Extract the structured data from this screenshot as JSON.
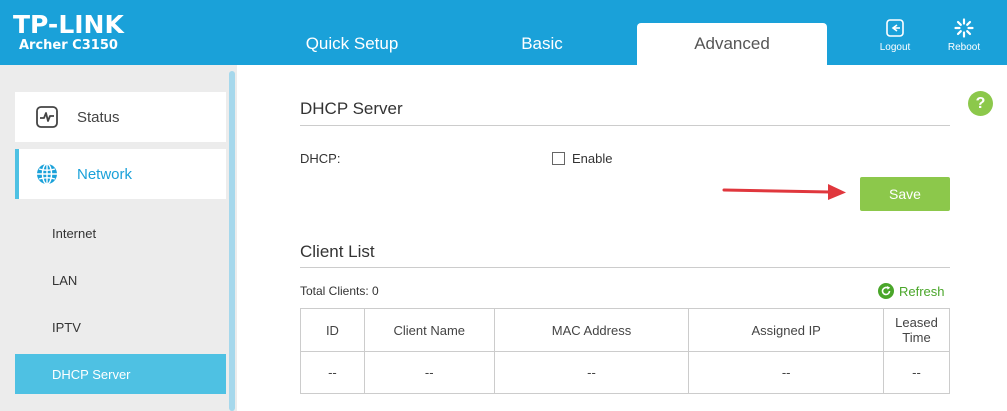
{
  "header": {
    "brand": "TP-LINK",
    "model": "Archer C3150",
    "tabs": [
      {
        "label": "Quick Setup"
      },
      {
        "label": "Basic"
      },
      {
        "label": "Advanced"
      }
    ],
    "logout_label": "Logout",
    "reboot_label": "Reboot"
  },
  "sidebar": {
    "main_items": [
      {
        "label": "Status",
        "icon": "status-icon"
      },
      {
        "label": "Network",
        "icon": "globe-icon"
      }
    ],
    "sub_items": [
      {
        "label": "Internet"
      },
      {
        "label": "LAN"
      },
      {
        "label": "IPTV"
      },
      {
        "label": "DHCP Server"
      }
    ],
    "active_sub": "DHCP Server"
  },
  "main": {
    "dhcp_title": "DHCP Server",
    "dhcp_label": "DHCP:",
    "enable_label": "Enable",
    "enable_checked": false,
    "save_label": "Save",
    "help_label": "?",
    "client_list_title": "Client List",
    "total_clients": "Total Clients: 0",
    "refresh_label": "Refresh",
    "table": {
      "headers": [
        "ID",
        "Client Name",
        "MAC Address",
        "Assigned IP",
        "Leased Time"
      ],
      "rows": [
        [
          "--",
          "--",
          "--",
          "--",
          "--"
        ]
      ]
    }
  },
  "colors": {
    "header_blue": "#1aa1d9",
    "accent_cyan": "#4ec1e3",
    "green": "#8cc84b",
    "arrow_red": "#e0373d"
  }
}
